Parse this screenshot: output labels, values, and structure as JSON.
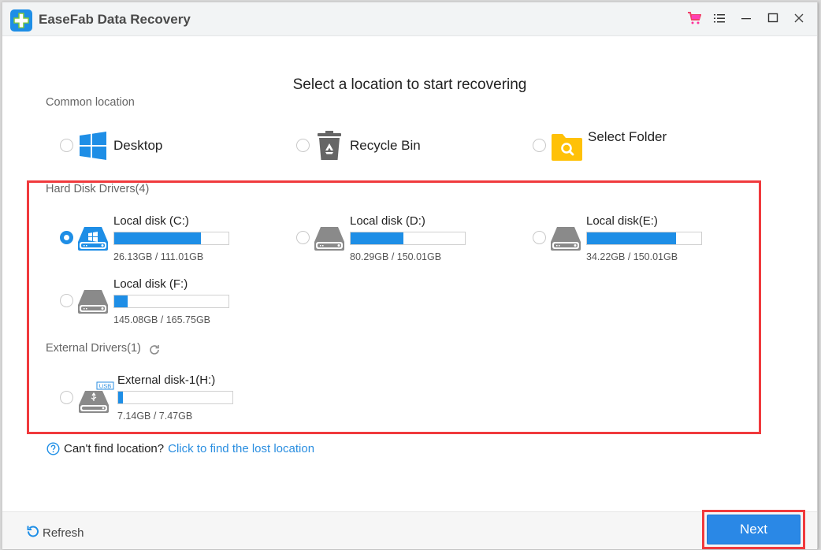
{
  "app": {
    "title": "EaseFab Data Recovery",
    "titlebar_icons": [
      "cart-icon",
      "menu-icon",
      "minimize-icon",
      "maximize-icon",
      "close-icon"
    ]
  },
  "main": {
    "heading": "Select a location to start recovering",
    "common_section_label": "Common location",
    "common_locations": [
      {
        "label": "Desktop",
        "icon": "windows-icon",
        "selected": false
      },
      {
        "label": "Recycle Bin",
        "icon": "recycle-bin-icon",
        "selected": false
      },
      {
        "label": "Select Folder",
        "icon": "folder-search-icon",
        "selected": false
      }
    ],
    "hard_disk_section_label": "Hard Disk Drivers(4)",
    "hard_disks": [
      {
        "name": "Local disk (C:)",
        "size": "26.13GB / 111.01GB",
        "fill_percent": 76,
        "selected": true,
        "system": true
      },
      {
        "name": "Local disk (D:)",
        "size": "80.29GB / 150.01GB",
        "fill_percent": 46,
        "selected": false,
        "system": false
      },
      {
        "name": "Local disk(E:)",
        "size": "34.22GB / 150.01GB",
        "fill_percent": 78,
        "selected": false,
        "system": false
      },
      {
        "name": "Local disk (F:)",
        "size": "145.08GB / 165.75GB",
        "fill_percent": 12,
        "selected": false,
        "system": false
      }
    ],
    "external_section_label": "External Drivers(1)",
    "external_disks": [
      {
        "name": "External disk-1(H:)",
        "size": "7.14GB / 7.47GB",
        "fill_percent": 4,
        "selected": false,
        "badge": "USB"
      }
    ],
    "help_text": "Can't find location?",
    "help_link": "Click to find the lost location"
  },
  "footer": {
    "refresh_label": "Refresh",
    "next_label": "Next"
  },
  "colors": {
    "accent": "#1e8ee6",
    "highlight": "#f03a3d",
    "link": "#2a8ee0",
    "folder": "#ffc107",
    "drive_gray": "#8a8a8a"
  }
}
